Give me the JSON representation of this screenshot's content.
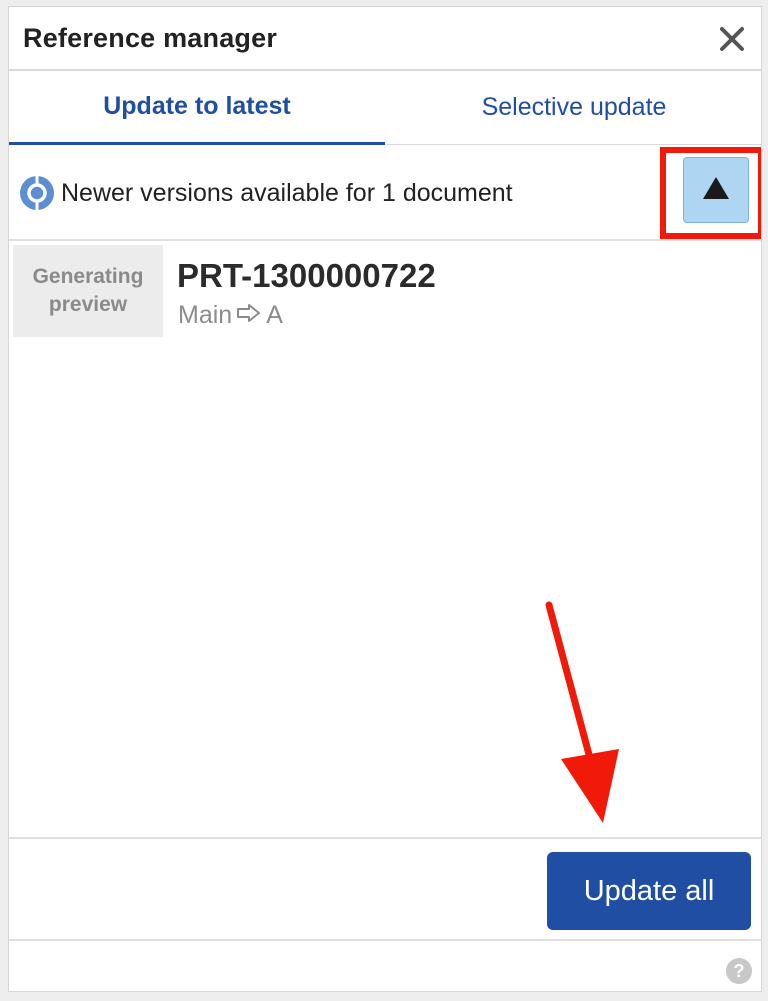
{
  "dialog": {
    "title": "Reference manager",
    "close_icon": "close-icon"
  },
  "tabs": [
    {
      "label": "Update to latest",
      "active": true
    },
    {
      "label": "Selective update",
      "active": false
    }
  ],
  "notice": {
    "icon": "info-icon",
    "text": "Newer versions available for 1 document",
    "collapse_icon": "triangle-up-icon"
  },
  "document": {
    "thumbnail_line1": "Generating",
    "thumbnail_line2": "preview",
    "name": "PRT-1300000722",
    "from_version": "Main",
    "to_version": "A",
    "arrow_icon": "right-arrow-outline-icon"
  },
  "footer": {
    "update_all_label": "Update all",
    "help_icon": "help-icon"
  },
  "colors": {
    "accent": "#1f4ea3",
    "annotation_red": "#f11a0a",
    "collapse_button_bg": "#aed6f2"
  }
}
